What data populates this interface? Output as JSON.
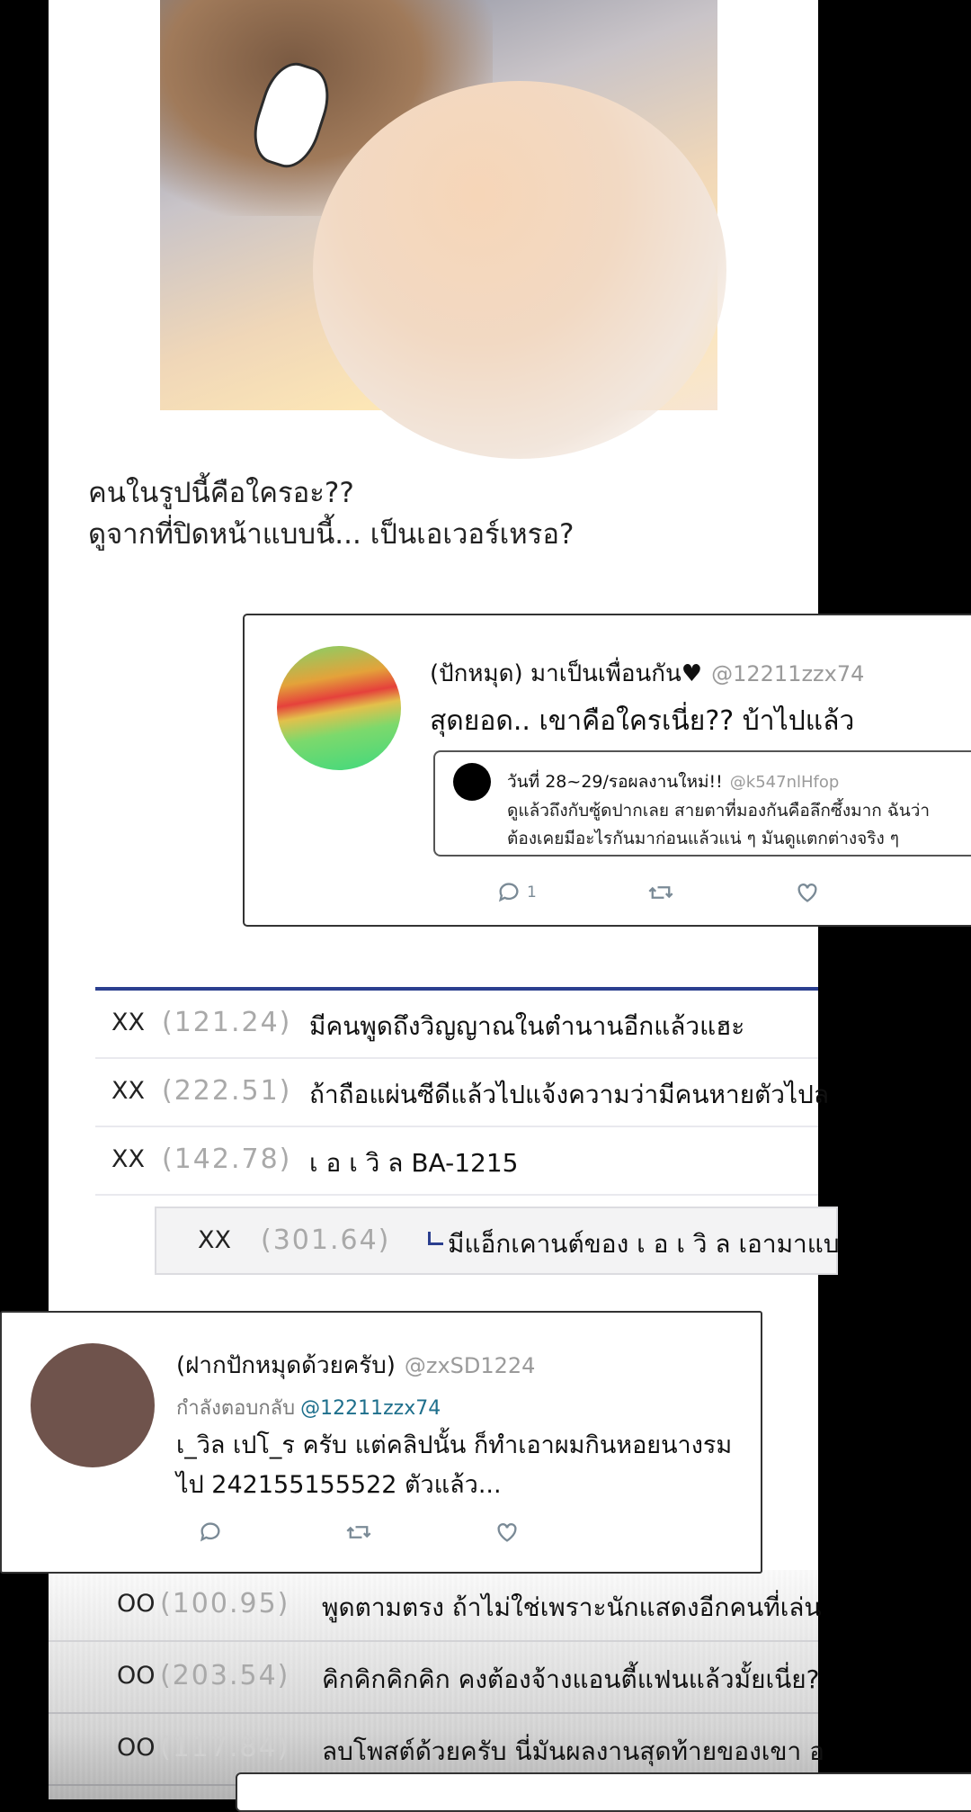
{
  "caption": {
    "line1": "คนในรูปนี้คือใครอะ??",
    "line2": "ดูจากที่ปิดหน้าแบบนี้... เป็นเอเวอร์เหรอ?"
  },
  "tweet1": {
    "name": "(ปักหมุด) มาเป็นเพื่อนกัน♥",
    "handle": "@12211zzx74",
    "text": "สุดยอด.. เขาคือใครเนี่ย?? บ้าไปแล้ว",
    "quote": {
      "name": "วันที่ 28~29/รอผลงานใหม่!!",
      "handle": "@k547nlHfop",
      "line1": "ดูแล้วถึงกับซู้ดปากเลย สายตาที่มองกันคือลึกซึ้งมาก ฉันว่า",
      "line2": "ต้องเคยมีอะไรกันมาก่อนแล้วแน่ ๆ มันดูแตกต่างจริง ๆ"
    },
    "reply_count": "1"
  },
  "thread": {
    "rows": [
      {
        "id": "XX",
        "score": "(121.24)",
        "text": "มีคนพูดถึงวิญญาณในตำนานอีกแล้วแฮะ"
      },
      {
        "id": "XX",
        "score": "(222.51)",
        "text": "ถ้าถือแผ่นซีดีแล้วไปแจ้งความว่ามีคนหายตัวไปล"
      },
      {
        "id": "XX",
        "score": "(142.78)",
        "text": "เ อ เ วิ ล BA-1215"
      }
    ],
    "reply": {
      "id": "XX",
      "score": "(301.64)",
      "text": "มีแอ็กเคานต์ของ เ อ เ วิ ล เอามาแบ"
    }
  },
  "tweet2": {
    "name": "(ฝากปักหมุดด้วยครับ)",
    "handle": "@zxSD1224",
    "replying_to_label": "กำลังตอบกลับ",
    "replying_to": "@12211zzx74",
    "line1": "เ_วิล เปโ_ร ครับ แต่คลิปนั้น ก็ทำเอาผมกินหอยนางรม",
    "line2": "ไป 242155155522 ตัวแล้ว..."
  },
  "lower_thread": {
    "rows": [
      {
        "id": "OO",
        "score": "(100.95)",
        "text": "พูดตามตรง ถ้าไม่ใช่เพราะนักแสดงอีกคนที่เล่น"
      },
      {
        "id": "OO",
        "score": "(203.54)",
        "text": "คิกคิกคิกคิก คงต้องจ้างแอนตี้แฟนแล้วมั้ยเนี่ย?"
      },
      {
        "id": "OO",
        "score": "(117.84)",
        "text": "ลบโพสต์ด้วยครับ นี่มันผลงานสุดท้ายของเขา อ"
      }
    ]
  },
  "colors": {
    "accent_blue": "#2b3f8f",
    "mention": "#1e6f8c",
    "muted": "#9a9a9a"
  }
}
